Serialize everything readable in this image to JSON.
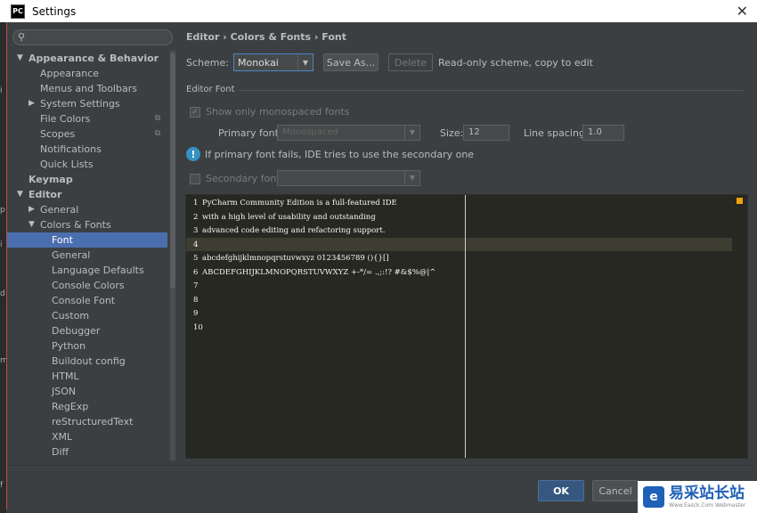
{
  "window": {
    "title": "Settings",
    "app_icon": "PC"
  },
  "search": {
    "placeholder": ""
  },
  "tree": [
    {
      "label": "Appearance & Behavior",
      "level": 0,
      "bold": true,
      "arrow": "down"
    },
    {
      "label": "Appearance",
      "level": 1
    },
    {
      "label": "Menus and Toolbars",
      "level": 1
    },
    {
      "label": "System Settings",
      "level": 1,
      "arrow": "right"
    },
    {
      "label": "File Colors",
      "level": 1,
      "copy": true
    },
    {
      "label": "Scopes",
      "level": 1,
      "copy": true
    },
    {
      "label": "Notifications",
      "level": 1
    },
    {
      "label": "Quick Lists",
      "level": 1
    },
    {
      "label": "Keymap",
      "level": 0,
      "bold": true
    },
    {
      "label": "Editor",
      "level": 0,
      "bold": true,
      "arrow": "down"
    },
    {
      "label": "General",
      "level": 1,
      "arrow": "right"
    },
    {
      "label": "Colors & Fonts",
      "level": 1,
      "arrow": "down"
    },
    {
      "label": "Font",
      "level": 2,
      "selected": true
    },
    {
      "label": "General",
      "level": 2
    },
    {
      "label": "Language Defaults",
      "level": 2
    },
    {
      "label": "Console Colors",
      "level": 2
    },
    {
      "label": "Console Font",
      "level": 2
    },
    {
      "label": "Custom",
      "level": 2
    },
    {
      "label": "Debugger",
      "level": 2
    },
    {
      "label": "Python",
      "level": 2
    },
    {
      "label": "Buildout config",
      "level": 2
    },
    {
      "label": "HTML",
      "level": 2
    },
    {
      "label": "JSON",
      "level": 2
    },
    {
      "label": "RegExp",
      "level": 2
    },
    {
      "label": "reStructuredText",
      "level": 2
    },
    {
      "label": "XML",
      "level": 2
    },
    {
      "label": "Diff",
      "level": 2
    }
  ],
  "breadcrumb": {
    "part1": "Editor",
    "sep1": " › ",
    "part2": "Colors & Fonts",
    "sep2": " › ",
    "part3": "Font"
  },
  "scheme": {
    "label": "Scheme:",
    "value": "Monokai",
    "save_as": "Save As...",
    "delete": "Delete",
    "hint": "Read-only scheme, copy to edit"
  },
  "editor_font": {
    "section": "Editor Font",
    "mono_only": "Show only monospaced fonts",
    "primary_label": "Primary font:",
    "primary_value": "Monospaced",
    "size_label": "Size:",
    "size_value": "12",
    "spacing_label": "Line spacing:",
    "spacing_value": "1.0",
    "info": "If primary font fails, IDE tries to use the secondary one",
    "secondary_label": "Secondary font:",
    "secondary_value": ""
  },
  "preview": {
    "lines": [
      {
        "n": "1",
        "text": "PyCharm Community Edition is a full-featured IDE"
      },
      {
        "n": "2",
        "text": "with a high level of usability and outstanding"
      },
      {
        "n": "3",
        "text": "advanced code editing and refactoring support."
      },
      {
        "n": "4",
        "text": ""
      },
      {
        "n": "5",
        "text": "abcdefghijklmnopqrstuvwxyz 0123456789 (){}[]"
      },
      {
        "n": "6",
        "text": "ABCDEFGHIJKLMNOPQRSTUVWXYZ +-*/= .,;:!? #&$%@|^"
      },
      {
        "n": "7",
        "text": ""
      },
      {
        "n": "8",
        "text": ""
      },
      {
        "n": "9",
        "text": ""
      },
      {
        "n": "10",
        "text": ""
      }
    ]
  },
  "buttons": {
    "ok": "OK",
    "cancel": "Cancel"
  },
  "watermark": {
    "t1": "易采站长站",
    "t2": "Www.Easck.Com  Webmaster"
  },
  "left_edge_glyphs": [
    "i",
    "p",
    "i",
    "d",
    "m",
    "f"
  ]
}
